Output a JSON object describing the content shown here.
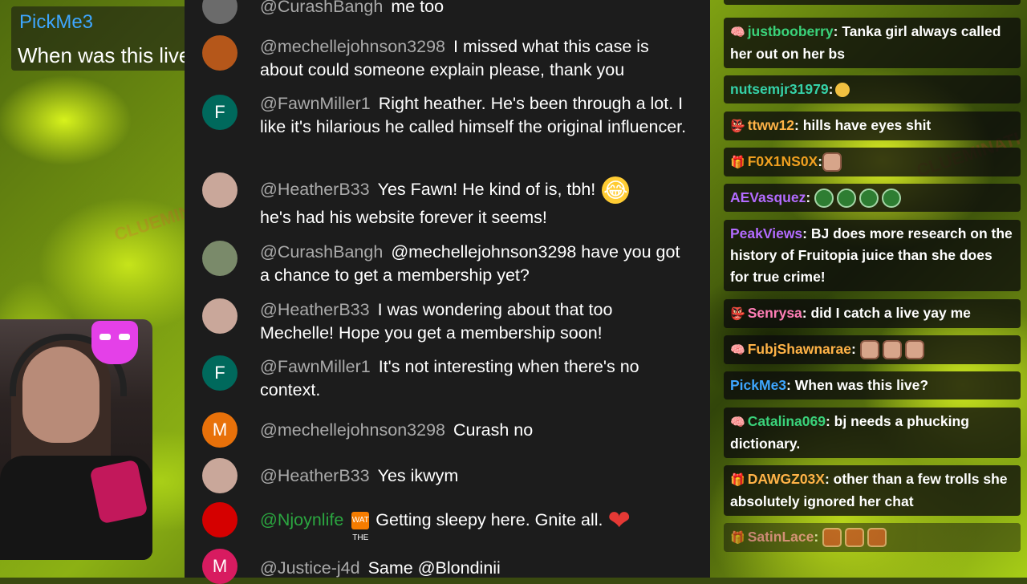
{
  "overlay_chat": {
    "username": "PickMe3",
    "message": "When was this live?"
  },
  "youtube_chat": {
    "messages": [
      {
        "avatar_letter": "",
        "avatar_color": "#6b6b6b",
        "author": "@CurashBangh",
        "text": "me too"
      },
      {
        "avatar_letter": "",
        "avatar_color": "#d2691e",
        "author": "@mechellejohnson3298",
        "text": "I missed what this case is about could someone explain please, thank you"
      },
      {
        "avatar_letter": "F",
        "avatar_color": "#00695c",
        "author": "@FawnMiller1",
        "text": "Right heather. He's been through a lot. I like it's hilarious he called himself the original influencer."
      },
      {
        "avatar_letter": "",
        "avatar_color": "#c9a79a",
        "author": "@HeatherB33",
        "text": "Yes Fawn! He kind of is, tbh!",
        "text2": "he's had his website forever it seems!"
      },
      {
        "avatar_letter": "",
        "avatar_color": "#7a8a6a",
        "author": "@CurashBangh",
        "text": "@mechellejohnson3298 have you got a chance to get a membership yet?"
      },
      {
        "avatar_letter": "",
        "avatar_color": "#c9a79a",
        "author": "@HeatherB33",
        "text": "I was wondering about that too Mechelle! Hope you get a membership soon!"
      },
      {
        "avatar_letter": "F",
        "avatar_color": "#00695c",
        "author": "@FawnMiller1",
        "text": "It's not interesting when there's no context."
      },
      {
        "avatar_letter": "M",
        "avatar_color": "#e8710a",
        "author": "@mechellejohnson3298",
        "text": "Curash no"
      },
      {
        "avatar_letter": "",
        "avatar_color": "#c9a79a",
        "author": "@HeatherB33",
        "text": "Yes ikwym"
      },
      {
        "avatar_letter": "",
        "avatar_color": "#d50000",
        "author": "@Njoynlife",
        "badge": "WAT THE",
        "text": "Getting sleepy here. Gnite all."
      },
      {
        "avatar_letter": "M",
        "avatar_color": "#d81b60",
        "author": "@Justice-j4d",
        "text": "Same @Blondinii"
      }
    ]
  },
  "twitch_chat": {
    "messages": [
      {
        "user": "justbooberry",
        "color": "#3ad27a",
        "text": ": Tanka girl always called her out on her bs",
        "icon": "brain-icon"
      },
      {
        "user": "nutsemjr31979",
        "color": "#35d1a8",
        "text": ":",
        "icon": ""
      },
      {
        "user": "ttww12",
        "color": "#ffb347",
        "text": ": hills have eyes shit",
        "icon": "mask-icon"
      },
      {
        "user": "F0X1NS0X",
        "color": "#f0a020",
        "text": ":",
        "icon": "gift-icon"
      },
      {
        "user": "AEVasquez",
        "color": "#b36bff",
        "text": ":",
        "icon": ""
      },
      {
        "user": "PeakViews",
        "color": "#b36bff",
        "text": ": BJ does more research on the history of Fruitopia juice than she does for true crime!",
        "icon": ""
      },
      {
        "user": "Senrysa",
        "color": "#ff7eb6",
        "text": ": did I catch a live yay me",
        "icon": "mask-icon"
      },
      {
        "user": "FubjShawnarae",
        "color": "#ffb347",
        "text": ":",
        "icon": "brain-icon"
      },
      {
        "user": "PickMe3",
        "color": "#3ea6ff",
        "text": ": When was this live?",
        "icon": ""
      },
      {
        "user": "Catalina069",
        "color": "#3ad27a",
        "text": ": bj needs a phucking dictionary.",
        "icon": "brain-icon"
      },
      {
        "user": "DAWGZ03X",
        "color": "#ffb347",
        "text": ": other than a few trolls she absolutely ignored her chat",
        "icon": "gift-icon"
      },
      {
        "user": "SatinLace",
        "color": "#ff7eb6",
        "text": ":",
        "icon": "gift-icon"
      }
    ]
  },
  "watermark": {
    "text": "CLUEMINATI"
  }
}
